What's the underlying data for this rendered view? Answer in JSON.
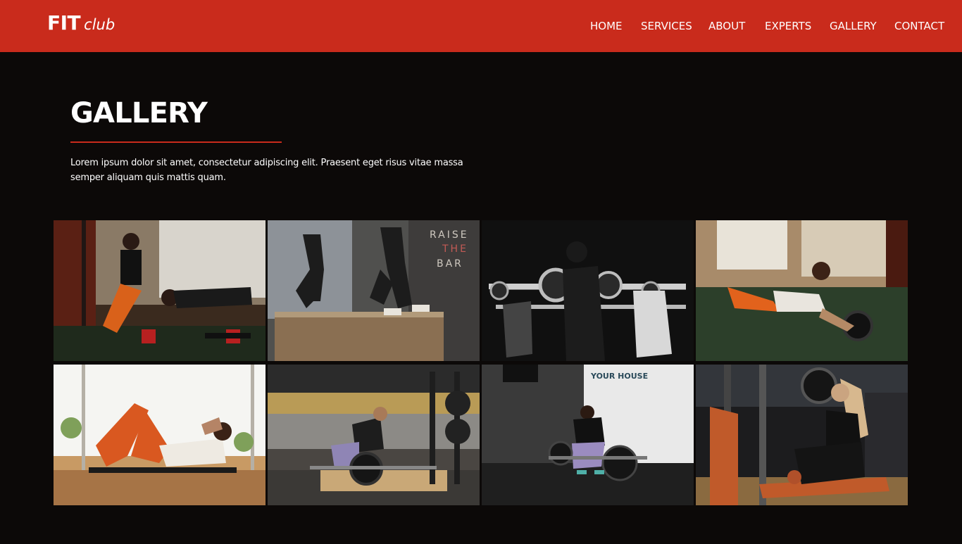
{
  "brand": {
    "primary": "FIT",
    "secondary": "club",
    "accent_color": "#c92b1c",
    "background_color": "#0c0908"
  },
  "nav": {
    "items": [
      {
        "label": "HOME"
      },
      {
        "label": "SERVICES"
      },
      {
        "label": "ABOUT"
      },
      {
        "label": "EXPERTS"
      },
      {
        "label": "GALLERY"
      },
      {
        "label": "CONTACT"
      }
    ]
  },
  "section": {
    "title": "GALLERY",
    "description": "Lorem ipsum dolor sit amet, consectetur adipiscing elit. Praesent eget risus vitae massa semper aliquam quis mattis quam."
  },
  "gallery": {
    "photos": [
      {
        "wall_text": []
      },
      {
        "wall_text": [
          "RAISE",
          "THE",
          "BAR"
        ]
      },
      {
        "wall_text": []
      },
      {
        "wall_text": []
      },
      {
        "wall_text": []
      },
      {
        "wall_text": []
      },
      {
        "wall_text": [
          "YOUR HOUSE"
        ]
      },
      {
        "wall_text": []
      }
    ]
  }
}
